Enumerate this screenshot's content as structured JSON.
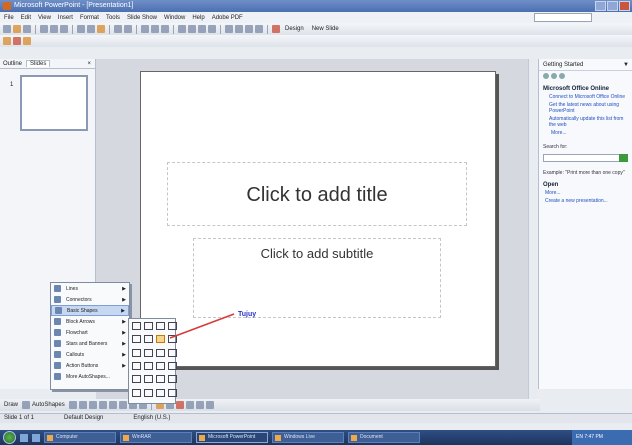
{
  "window": {
    "title": "Microsoft PowerPoint - [Presentation1]",
    "controls": [
      "minimize",
      "maximize",
      "close"
    ]
  },
  "menubar": {
    "items": [
      "File",
      "Edit",
      "View",
      "Insert",
      "Format",
      "Tools",
      "Slide Show",
      "Window",
      "Help",
      "Adobe PDF"
    ],
    "help_placeholder": "Type a question for help"
  },
  "toolbar": {
    "design_label": "Design",
    "new_slide_label": "New Slide"
  },
  "left_pane": {
    "tabs": [
      "Outline",
      "Slides"
    ],
    "slide_number": "1"
  },
  "slide": {
    "title_placeholder": "Click to add title",
    "subtitle_placeholder": "Click to add subtitle"
  },
  "right_pane": {
    "header": "Getting Started",
    "office_online_heading": "Microsoft Office Online",
    "links": [
      "Connect to Microsoft Office Online",
      "Get the latest news about using PowerPoint",
      "Automatically update this list from the web"
    ],
    "more_link": "More...",
    "search_label": "Search for:",
    "example_text": "Example: \"Print more than one copy\"",
    "open_heading": "Open",
    "open_link": "More...",
    "create_link": "Create a new presentation..."
  },
  "autoshapes_menu": {
    "items": [
      "Lines",
      "Connectors",
      "Basic Shapes",
      "Block Arrows",
      "Flowchart",
      "Stars and Banners",
      "Callouts",
      "Action Buttons",
      "More AutoShapes..."
    ],
    "highlighted_index": 2
  },
  "annotation": {
    "label": "Tujuy",
    "color": "#2832c8"
  },
  "drawbar": {
    "draw_label": "Draw",
    "autoshapes_label": "AutoShapes"
  },
  "statusbar": {
    "slide_info": "Slide 1 of 1",
    "design": "Default Design",
    "language": "English (U.S.)"
  },
  "taskbar": {
    "buttons": [
      "Computer",
      "WinRAR",
      "Microsoft PowerPoint",
      "Windows Live",
      "Document"
    ],
    "active_index": 2,
    "tray_time": "EN 7:47 PM"
  }
}
